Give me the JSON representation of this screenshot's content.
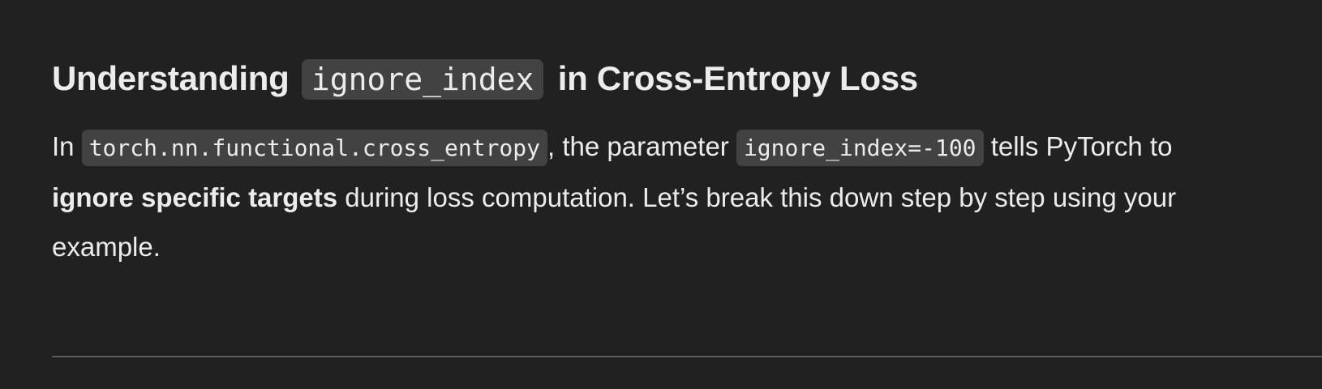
{
  "heading": {
    "prefix": "Understanding",
    "code": "ignore_index",
    "suffix": "in Cross-Entropy Loss"
  },
  "paragraph": {
    "lead": "In",
    "code_function": "torch.nn.functional.cross_entropy",
    "text_after_function": ", the parameter",
    "code_param": "ignore_index=-100",
    "text_after_param": "tells PyTorch to",
    "bold": "ignore specific targets",
    "text_line2": "during loss computation. Let’s break this down step by step using your",
    "text_line3": "example."
  }
}
